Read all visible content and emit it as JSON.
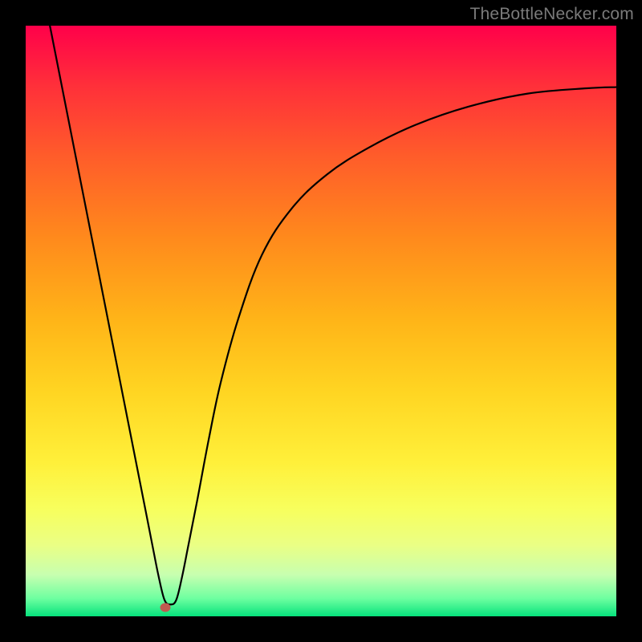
{
  "watermark": "TheBottleNecker.com",
  "marker": {
    "xFrac": 0.236,
    "yFrac": 0.985
  },
  "colors": {
    "border": "#000000",
    "curve": "#000000",
    "marker": "#c05a50",
    "watermark": "#7a7a7a"
  },
  "chart_data": {
    "type": "line",
    "title": "",
    "xlabel": "",
    "ylabel": "",
    "xlim": [
      0,
      1
    ],
    "ylim": [
      0,
      1
    ],
    "grid": false,
    "legend": "none",
    "series": [
      {
        "name": "curve",
        "x": [
          0.041,
          0.1,
          0.16,
          0.205,
          0.215,
          0.225,
          0.235,
          0.245,
          0.255,
          0.265,
          0.275,
          0.29,
          0.31,
          0.33,
          0.36,
          0.4,
          0.45,
          0.51,
          0.58,
          0.66,
          0.75,
          0.85,
          0.95,
          1.0
        ],
        "y": [
          1.0,
          0.701,
          0.397,
          0.169,
          0.118,
          0.068,
          0.028,
          0.02,
          0.028,
          0.068,
          0.118,
          0.194,
          0.3,
          0.395,
          0.504,
          0.612,
          0.69,
          0.748,
          0.793,
          0.832,
          0.863,
          0.885,
          0.894,
          0.896
        ]
      }
    ],
    "markers": [
      {
        "name": "optimum",
        "x": 0.236,
        "y": 0.015
      }
    ],
    "annotations": []
  }
}
